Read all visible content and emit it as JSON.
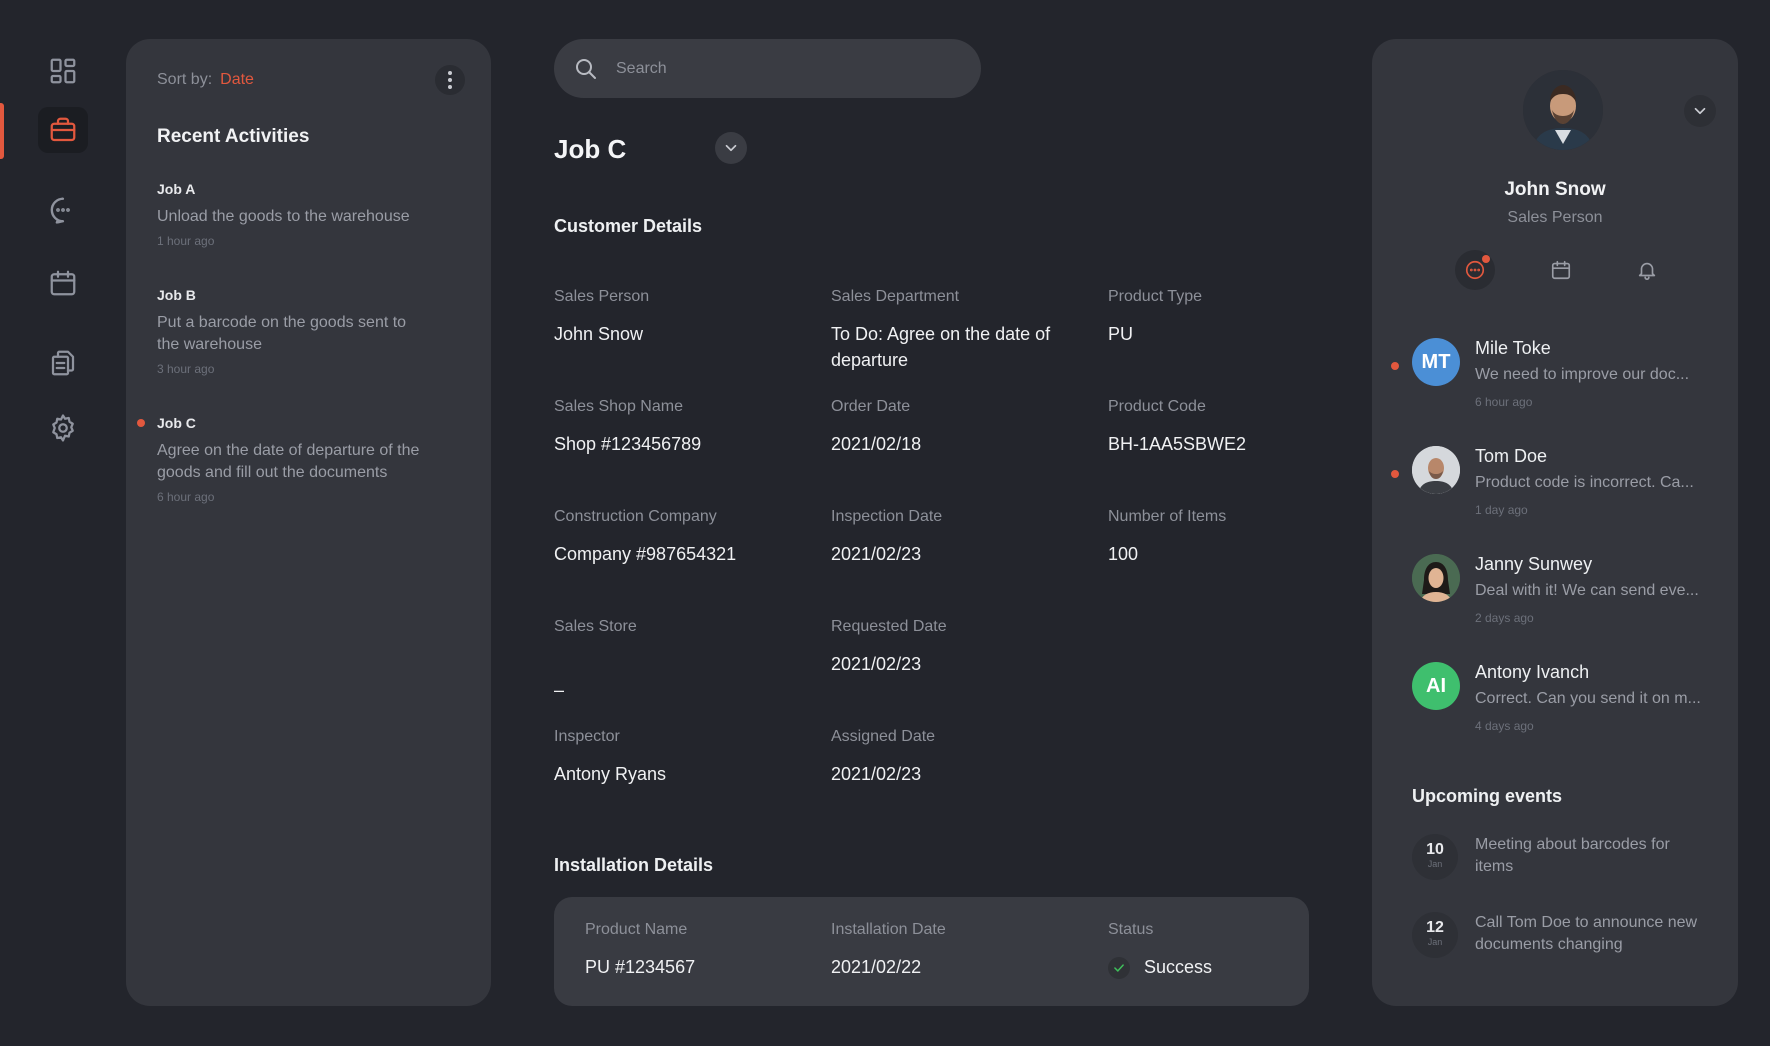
{
  "nav": {
    "items": [
      {
        "name": "dashboard-icon"
      },
      {
        "name": "briefcase-icon",
        "active": true
      },
      {
        "name": "chat-icon"
      },
      {
        "name": "calendar-icon"
      },
      {
        "name": "documents-icon"
      },
      {
        "name": "settings-icon"
      }
    ],
    "accent_color": "#e2583e"
  },
  "activities": {
    "sort_label": "Sort by:",
    "sort_value": "Date",
    "title": "Recent Activities",
    "items": [
      {
        "job": "Job A",
        "desc": "Unload the goods to the warehouse",
        "time": "1 hour ago",
        "active": false
      },
      {
        "job": "Job B",
        "desc": "Put a barcode on the goods sent to the warehouse",
        "time": "3 hour ago",
        "active": false
      },
      {
        "job": "Job C",
        "desc": "Agree on the date of departure of the goods and fill out the documents",
        "time": "6 hour ago",
        "active": true
      }
    ]
  },
  "search": {
    "placeholder": "Search"
  },
  "job": {
    "title": "Job C"
  },
  "customer": {
    "title": "Customer Details",
    "fields": {
      "sales_person": {
        "label": "Sales Person",
        "value": "John Snow"
      },
      "sales_department": {
        "label": "Sales Department",
        "value": "To Do: Agree on the date of departure"
      },
      "product_type": {
        "label": "Product Type",
        "value": "PU"
      },
      "sales_shop_name": {
        "label": "Sales Shop Name",
        "value": "Shop #123456789"
      },
      "order_date": {
        "label": "Order Date",
        "value": "2021/02/18"
      },
      "product_code": {
        "label": "Product Code",
        "value": "BH-1AA5SBWE2"
      },
      "construction_company": {
        "label": "Construction Company",
        "value": "Company #987654321"
      },
      "inspection_date": {
        "label": "Inspection Date",
        "value": "2021/02/23"
      },
      "number_of_items": {
        "label": "Number of Items",
        "value": "100"
      },
      "sales_store": {
        "label": "Sales Store",
        "value": "–"
      },
      "requested_date": {
        "label": "Requested Date",
        "value": "2021/02/23"
      },
      "inspector": {
        "label": "Inspector",
        "value": "Antony Ryans"
      },
      "assigned_date": {
        "label": "Assigned Date",
        "value": "2021/02/23"
      }
    }
  },
  "installation": {
    "title": "Installation Details",
    "product_name": {
      "label": "Product Name",
      "value": "PU #1234567"
    },
    "installation_date": {
      "label": "Installation Date",
      "value": "2021/02/22"
    },
    "status": {
      "label": "Status",
      "value": "Success",
      "color": "#3fbf5b"
    }
  },
  "profile": {
    "name": "John Snow",
    "role": "Sales Person",
    "messages": [
      {
        "initials": "MT",
        "name": "Mile Toke",
        "text": "We need to improve our doc...",
        "time": "6 hour ago",
        "unread": true,
        "color": "#4b8fd6"
      },
      {
        "initials": "",
        "name": "Tom Doe",
        "text": "Product code is incorrect. Ca...",
        "time": "1 day ago",
        "unread": true,
        "color": "#cfd2d6"
      },
      {
        "initials": "",
        "name": "Janny Sunwey",
        "text": "Deal with it! We can send eve...",
        "time": "2 days ago",
        "unread": false,
        "color": "#3f5a4a"
      },
      {
        "initials": "AI",
        "name": "Antony Ivanch",
        "text": "Correct. Can you send it on m...",
        "time": "4 days ago",
        "unread": false,
        "color": "#3fbf6e"
      }
    ],
    "events_title": "Upcoming events",
    "events": [
      {
        "day": "10",
        "month": "Jan",
        "text": "Meeting about barcodes for items"
      },
      {
        "day": "12",
        "month": "Jan",
        "text": "Call Tom Doe to announce new documents changing"
      }
    ]
  }
}
